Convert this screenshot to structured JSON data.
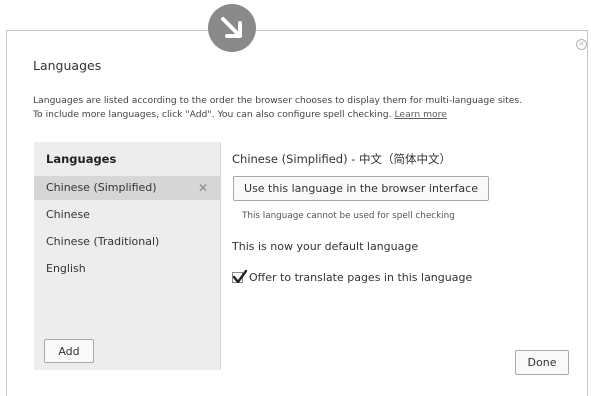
{
  "dialog": {
    "title": "Languages",
    "description_line1": "Languages are listed according to the order the browser chooses to display them for multi-language sites.",
    "description_line2": "To include more languages, click \"Add\". You can also configure spell checking.",
    "learn_more": "Learn more",
    "close_icon": "close-icon",
    "badge_icon": "arrow-down-right-icon"
  },
  "languages": {
    "header": "Languages",
    "items": [
      {
        "label": "Chinese (Simplified)",
        "selected": true
      },
      {
        "label": "Chinese",
        "selected": false
      },
      {
        "label": "Chinese (Traditional)",
        "selected": false
      },
      {
        "label": "English",
        "selected": false
      }
    ],
    "remove_glyph": "✕",
    "add_label": "Add"
  },
  "detail": {
    "title": "Chinese (Simplified) - 中文（简体中文）",
    "use_language_button": "Use this language in the browser interface",
    "spell_note": "This language cannot be used for spell checking",
    "default_note": "This is now your default language",
    "offer_translate": "Offer to translate pages in this language",
    "offer_translate_checked": true
  },
  "footer": {
    "done_label": "Done"
  }
}
